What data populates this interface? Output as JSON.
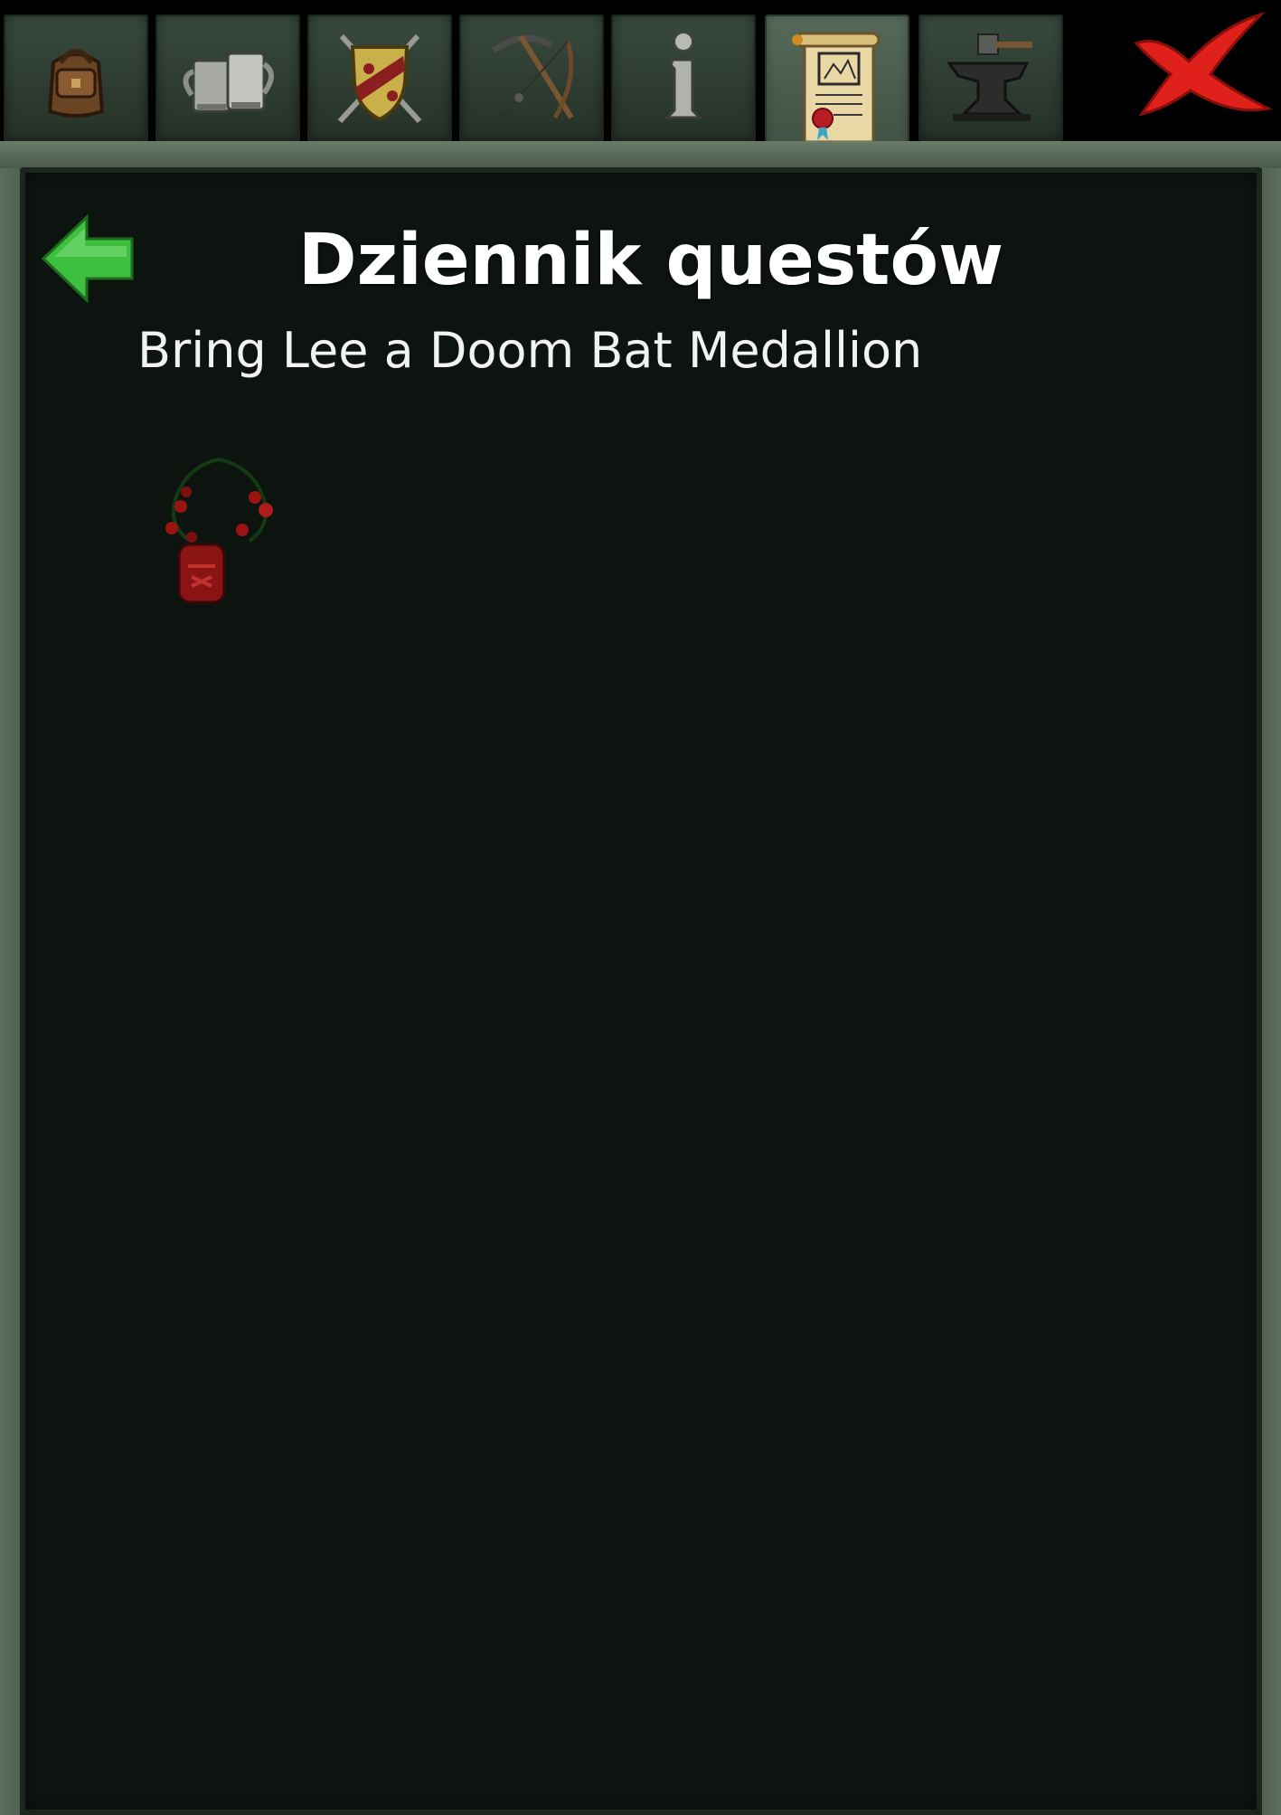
{
  "tabs": [
    {
      "id": "inventory",
      "icon": "backpack-icon",
      "active": false
    },
    {
      "id": "tavern",
      "icon": "tankards-icon",
      "active": false
    },
    {
      "id": "equipment",
      "icon": "shield-swords-icon",
      "active": false
    },
    {
      "id": "skills",
      "icon": "pickaxe-bow-icon",
      "active": false
    },
    {
      "id": "info",
      "icon": "info-icon",
      "active": false
    },
    {
      "id": "quest-log",
      "icon": "scroll-icon",
      "active": true
    },
    {
      "id": "crafting",
      "icon": "anvil-icon",
      "active": false
    }
  ],
  "close": {
    "icon": "red-x-icon"
  },
  "header": {
    "title": "Dziennik questów",
    "back_icon": "green-left-arrow-icon"
  },
  "quest": {
    "text": "Bring Lee a Doom Bat Medallion",
    "item_icon": "doom-bat-medallion-icon"
  },
  "colors": {
    "panel_bg": "#0d130e",
    "frame": "#4a5a4a",
    "tab_bg": "#2e3c31",
    "active_tab_bg": "#4d604f",
    "title_text": "#ffffff",
    "back_arrow": "#3fbf3f",
    "close_x": "#e0201a"
  }
}
